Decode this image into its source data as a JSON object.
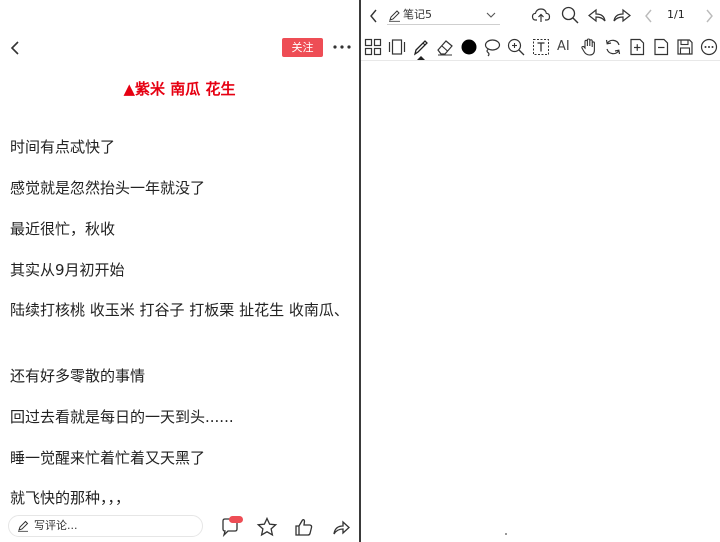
{
  "post": {
    "follow_label": "关注",
    "title": "▲紫米 南瓜 花生",
    "paragraphs": [
      "时间有点忒快了",
      "感觉就是忽然抬头一年就没了",
      "最近很忙，秋收",
      "其实从9月初开始",
      "陆续打核桃 收玉米 打谷子 打板栗 扯花生 收南瓜、",
      "还有好多零散的事情",
      "回过去看就是每日的一天到头......",
      "睡一觉醒来忙着忙着又天黑了",
      "就飞快的那种，，，"
    ],
    "comment_placeholder": "写评论..."
  },
  "note": {
    "name": "笔记5",
    "page_indicator": "1/1",
    "ai_label": "AI"
  },
  "colors": {
    "accent": "#ee4d55",
    "title": "#e60012"
  }
}
